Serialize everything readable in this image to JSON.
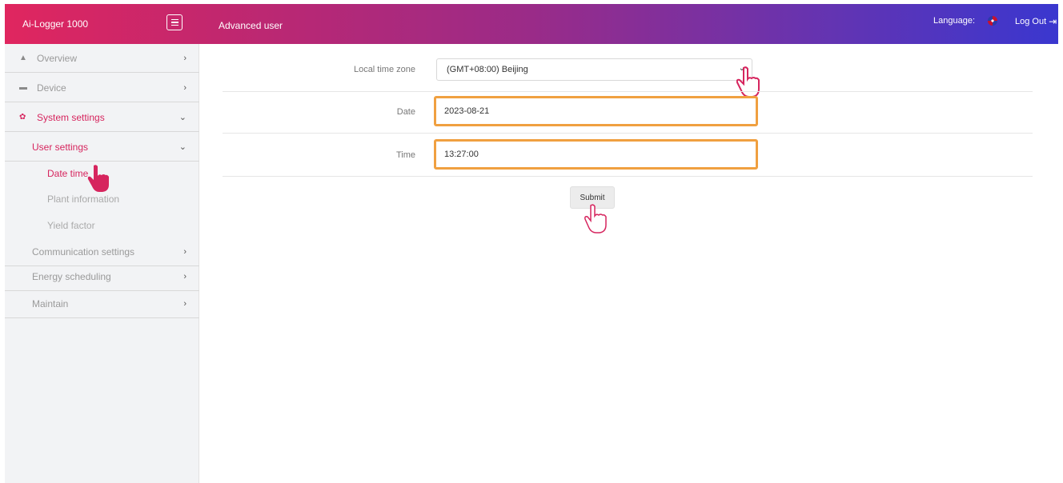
{
  "header": {
    "brand": "Ai-Logger 1000",
    "role": "Advanced user",
    "language_label": "Language:",
    "logout_label": "Log Out"
  },
  "sidebar": {
    "items": [
      {
        "label": "Overview",
        "icon": "home-icon"
      },
      {
        "label": "Device",
        "icon": "device-icon"
      },
      {
        "label": "System settings",
        "icon": "gear-icon"
      },
      {
        "label": "User settings"
      },
      {
        "label": "Communication settings"
      },
      {
        "label": "Energy scheduling"
      },
      {
        "label": "Maintain"
      }
    ],
    "leaves": [
      "Date time",
      "Plant information",
      "Yield factor"
    ]
  },
  "form": {
    "timezone_label": "Local time zone",
    "timezone_value": "(GMT+08:00) Beijing",
    "date_label": "Date",
    "date_value": "2023-08-21",
    "time_label": "Time",
    "time_value": "13:27:00",
    "submit_label": "Submit"
  },
  "colors": {
    "accent": "#d6255e",
    "highlight": "#f0a040"
  }
}
